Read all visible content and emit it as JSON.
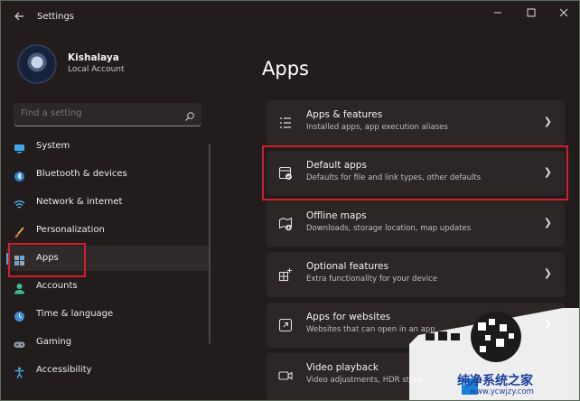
{
  "window": {
    "title": "Settings",
    "back_icon": "back-arrow-icon",
    "controls": [
      "minimize-icon",
      "maximize-icon",
      "close-icon"
    ]
  },
  "profile": {
    "name": "Kishalaya",
    "account_type": "Local Account"
  },
  "search": {
    "placeholder": "Find a setting",
    "icon": "search-icon"
  },
  "nav": {
    "items": [
      {
        "label": "System",
        "icon": "system-icon",
        "selected": false
      },
      {
        "label": "Bluetooth & devices",
        "icon": "bluetooth-icon",
        "selected": false
      },
      {
        "label": "Network & internet",
        "icon": "wifi-icon",
        "selected": false
      },
      {
        "label": "Personalization",
        "icon": "brush-icon",
        "selected": false
      },
      {
        "label": "Apps",
        "icon": "apps-icon",
        "selected": true
      },
      {
        "label": "Accounts",
        "icon": "person-icon",
        "selected": false
      },
      {
        "label": "Time & language",
        "icon": "globe-clock-icon",
        "selected": false
      },
      {
        "label": "Gaming",
        "icon": "gamepad-icon",
        "selected": false
      },
      {
        "label": "Accessibility",
        "icon": "accessibility-icon",
        "selected": false
      }
    ]
  },
  "main": {
    "title": "Apps",
    "cards": [
      {
        "title": "Apps & features",
        "desc": "Installed apps, app execution aliases",
        "icon": "list-icon"
      },
      {
        "title": "Default apps",
        "desc": "Defaults for file and link types, other defaults",
        "icon": "default-app-icon"
      },
      {
        "title": "Offline maps",
        "desc": "Downloads, storage location, map updates",
        "icon": "map-icon"
      },
      {
        "title": "Optional features",
        "desc": "Extra functionality for your device",
        "icon": "add-square-icon"
      },
      {
        "title": "Apps for websites",
        "desc": "Websites that can open in an app",
        "icon": "open-link-icon"
      },
      {
        "title": "Video playback",
        "desc": "Video adjustments, HDR strea",
        "icon": "video-icon"
      }
    ]
  },
  "colors": {
    "accent": "#4aa5e0",
    "highlight": "#d0202a",
    "background": "#221c1c",
    "card": "#2c2626"
  },
  "watermark": {
    "text": "纯净系统之家",
    "url": "www.ycwjzy.com"
  }
}
